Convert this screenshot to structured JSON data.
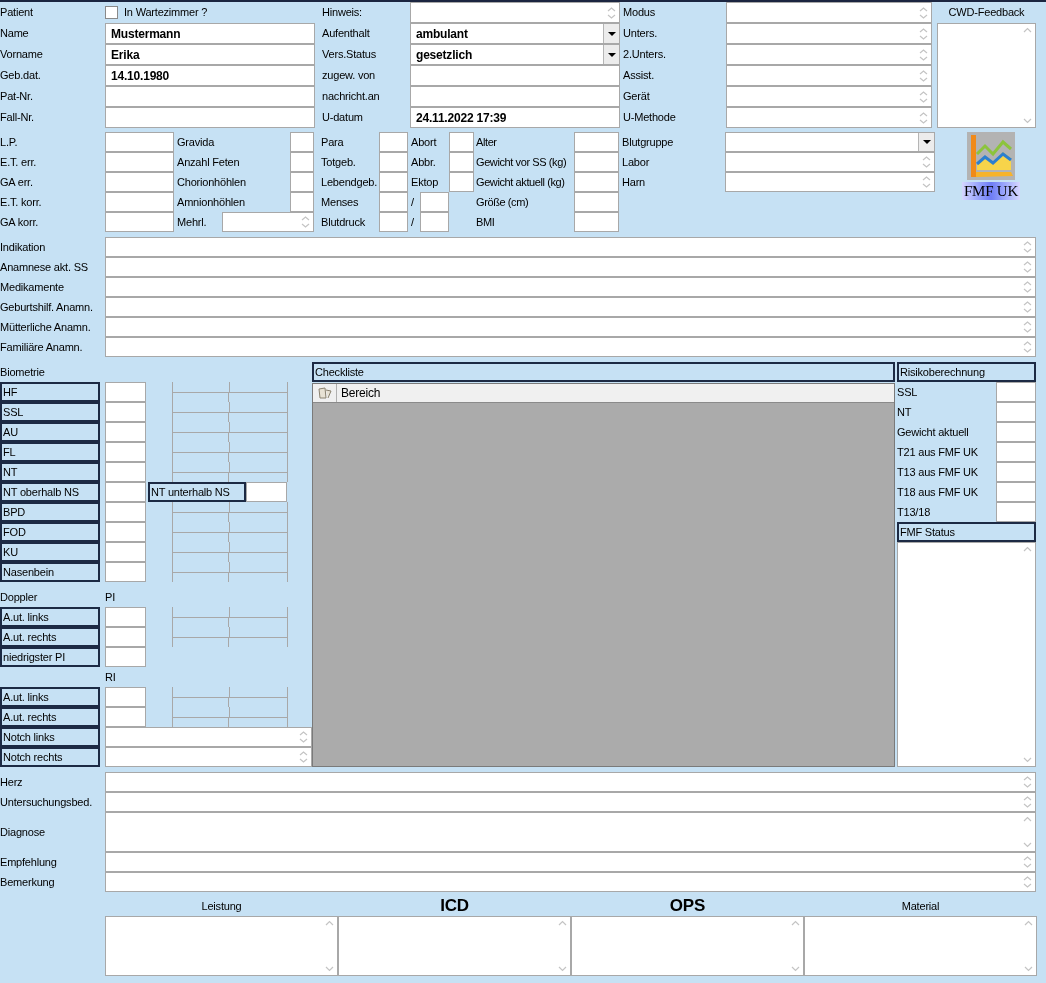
{
  "patient": {
    "label": "Patient",
    "waiting_room": {
      "label": "In Wartezimmer ?",
      "checked": false
    }
  },
  "top_left": [
    {
      "label": "Name",
      "value": "Mustermann"
    },
    {
      "label": "Vorname",
      "value": "Erika"
    },
    {
      "label": "Geb.dat.",
      "value": "14.10.1980"
    },
    {
      "label": "Pat-Nr."
    },
    {
      "label": "Fall-Nr."
    }
  ],
  "top_middle": [
    {
      "label": "Hinweis:",
      "kind": "spin"
    },
    {
      "label": "Aufenthalt",
      "kind": "dropdown",
      "value": "ambulant"
    },
    {
      "label": "Vers.Status",
      "kind": "dropdown",
      "value": "gesetzlich"
    },
    {
      "label": "zugew. von",
      "kind": "text"
    },
    {
      "label": "nachricht.an",
      "kind": "text"
    },
    {
      "label": "U-datum",
      "kind": "text",
      "value": "24.11.2022 17:39"
    }
  ],
  "top_right": [
    {
      "label": "Modus"
    },
    {
      "label": "Unters."
    },
    {
      "label": "2.Unters."
    },
    {
      "label": "Assist."
    },
    {
      "label": "Gerät"
    },
    {
      "label": "U-Methode"
    }
  ],
  "cwd_feedback": {
    "title": "CWD-Feedback"
  },
  "obstetrics": {
    "col1": [
      {
        "label": "L.P."
      },
      {
        "label": "E.T. err."
      },
      {
        "label": "GA err."
      },
      {
        "label": "E.T. korr."
      },
      {
        "label": "GA korr."
      }
    ],
    "col2": [
      {
        "label": "Gravida",
        "kind": "small"
      },
      {
        "label": "Anzahl Feten",
        "kind": "small"
      },
      {
        "label": "Chorionhöhlen",
        "kind": "small"
      },
      {
        "label": "Amnionhöhlen",
        "kind": "small"
      },
      {
        "label": "Mehrl.",
        "kind": "spin"
      }
    ],
    "col3": [
      {
        "label": "Para",
        "kind": "single"
      },
      {
        "label": "Totgeb.",
        "kind": "single"
      },
      {
        "label": "Lebendgeb.",
        "kind": "single"
      },
      {
        "label": "Menses",
        "kind": "pair",
        "separator": "/"
      },
      {
        "label": "Blutdruck",
        "kind": "pair",
        "separator": "/"
      }
    ],
    "col4": [
      {
        "label": "Abort"
      },
      {
        "label": "Abbr."
      },
      {
        "label": "Ektop"
      }
    ],
    "col5": [
      {
        "label": "Alter"
      },
      {
        "label": "Gewicht vor SS (kg)"
      },
      {
        "label": "Gewicht aktuell (kg)"
      },
      {
        "label": "Größe (cm)"
      },
      {
        "label": "BMI"
      }
    ],
    "col6": [
      {
        "label": "Blutgruppe",
        "kind": "dropdown"
      },
      {
        "label": "Labor",
        "kind": "spin"
      },
      {
        "label": "Harn",
        "kind": "spin"
      }
    ]
  },
  "fmf_button": {
    "label": "FMF UK"
  },
  "history": [
    {
      "label": "Indikation"
    },
    {
      "label": "Anamnese akt. SS"
    },
    {
      "label": "Medikamente"
    },
    {
      "label": "Geburtshilf. Anamn."
    },
    {
      "label": "Mütterliche Anamn."
    },
    {
      "label": "Familiäre Anamn."
    }
  ],
  "biometrie": {
    "title": "Biometrie",
    "rows": [
      {
        "label": "HF"
      },
      {
        "label": "SSL"
      },
      {
        "label": "AU"
      },
      {
        "label": "FL"
      },
      {
        "label": "NT"
      },
      {
        "label": "NT oberhalb NS",
        "extra": "NT unterhalb NS"
      },
      {
        "label": "BPD"
      },
      {
        "label": "FOD"
      },
      {
        "label": "KU"
      },
      {
        "label": "Nasenbein"
      }
    ]
  },
  "doppler": {
    "title": "Doppler",
    "pi_label": "PI",
    "pi_rows": [
      {
        "label": "A.ut. links"
      },
      {
        "label": "A.ut. rechts"
      },
      {
        "label": "niedrigster PI"
      }
    ],
    "ri_label": "RI",
    "ri_rows": [
      {
        "label": "A.ut. links"
      },
      {
        "label": "A.ut. rechts"
      }
    ],
    "notch_rows": [
      {
        "label": "Notch links"
      },
      {
        "label": "Notch rechts"
      }
    ]
  },
  "checklist": {
    "title": "Checkliste",
    "columns": [
      "Bereich"
    ]
  },
  "risk": {
    "title": "Risikoberechnung",
    "rows": [
      {
        "label": "SSL"
      },
      {
        "label": "NT"
      },
      {
        "label": "Gewicht aktuell"
      },
      {
        "label": "T21 aus FMF UK"
      },
      {
        "label": "T13 aus FMF UK"
      },
      {
        "label": "T18 aus FMF UK"
      },
      {
        "label": "T13/18"
      }
    ],
    "status_title": "FMF Status"
  },
  "findings": [
    {
      "label": "Herz",
      "kind": "line"
    },
    {
      "label": "Untersuchungsbed.",
      "kind": "line"
    },
    {
      "label": "Diagnose",
      "kind": "multiline"
    },
    {
      "label": "Empfehlung",
      "kind": "line"
    },
    {
      "label": "Bemerkung",
      "kind": "line"
    }
  ],
  "billing": [
    {
      "label": "Leistung",
      "bold": false
    },
    {
      "label": "ICD",
      "bold": true
    },
    {
      "label": "OPS",
      "bold": true
    },
    {
      "label": "Material",
      "bold": false
    }
  ]
}
